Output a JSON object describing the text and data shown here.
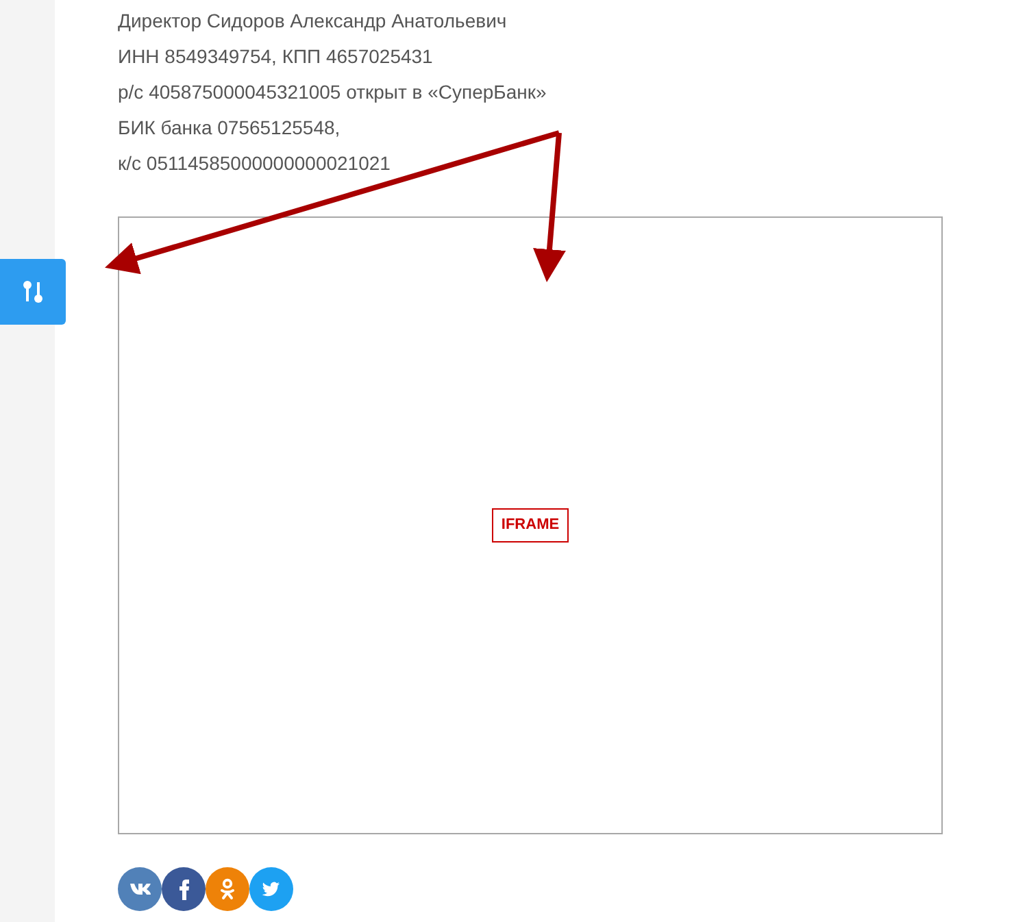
{
  "details": [
    "Директор Сидоров Александр Анатольевич",
    "ИНН 8549349754, КПП 4657025431",
    "р/с 405875000045321005 открыт в «СуперБанк»",
    "БИК банка 07565125548,",
    "к/с 05114585000000000021021"
  ],
  "embed": {
    "label": "IFRAME"
  },
  "share_buttons": [
    {
      "kind": "vk",
      "color": "#5181b8"
    },
    {
      "kind": "facebook",
      "color": "#3b5998"
    },
    {
      "kind": "ok",
      "color": "#ee8208"
    },
    {
      "kind": "twitter",
      "color": "#1da1f2"
    }
  ]
}
